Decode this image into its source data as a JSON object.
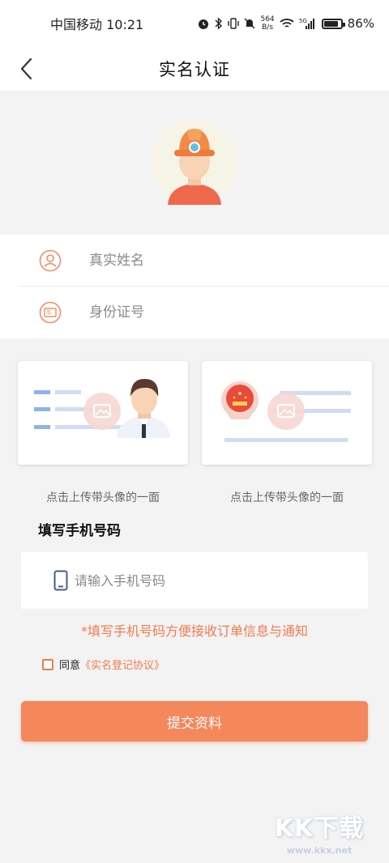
{
  "status_bar": {
    "carrier_time": "中国移动 10:21",
    "net_speed_value": "564",
    "net_speed_unit": "B/s",
    "network": "5G",
    "battery": "86%",
    "battery_level": 0.86
  },
  "nav": {
    "title": "实名认证"
  },
  "form": {
    "name_placeholder": "真实姓名",
    "id_placeholder": "身份证号"
  },
  "id_upload": {
    "front_caption": "点击上传带头像的一面",
    "back_caption": "点击上传带头像的一面"
  },
  "phone": {
    "heading": "填写手机号码",
    "placeholder": "请输入手机号码",
    "hint": "*填写手机号码方便接收订单信息与通知"
  },
  "agreement": {
    "prefix": "同意",
    "link": "《实名登记协议》",
    "checked": false
  },
  "submit_label": "提交资料",
  "watermark": {
    "logo": "KK下载",
    "url": "www.kkx.net"
  },
  "colors": {
    "accent": "#f07b4e",
    "button": "#f4875c",
    "background": "#f3f3f3"
  }
}
